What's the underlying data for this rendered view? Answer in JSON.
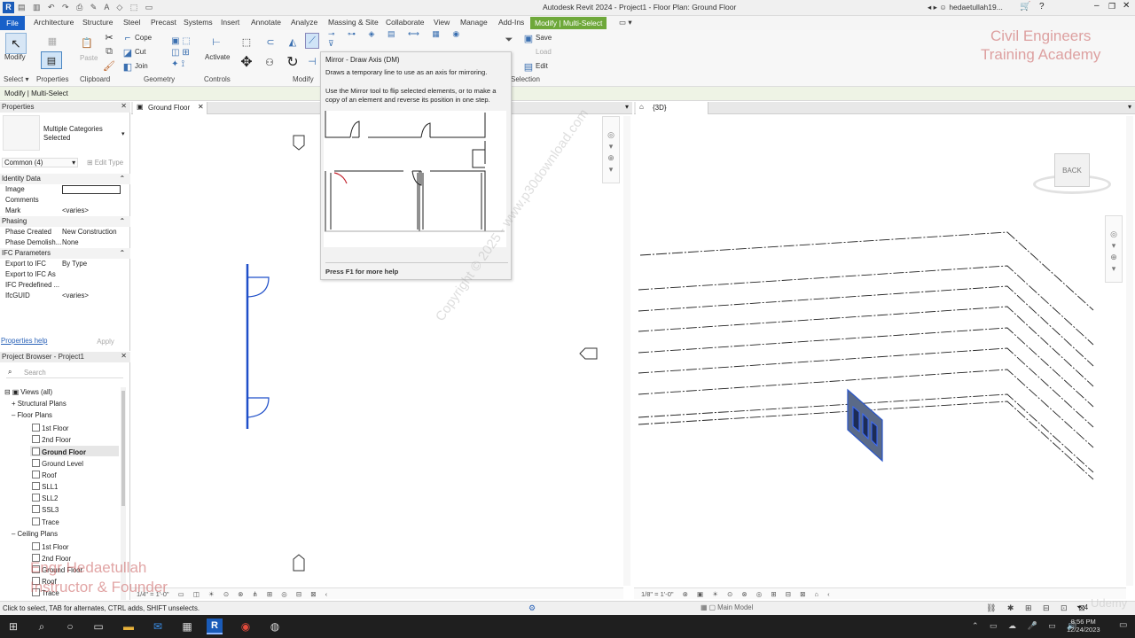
{
  "window": {
    "title": "Autodesk Revit 2024 - Project1 - Floor Plan: Ground Floor",
    "user": "hedaetullah19..."
  },
  "menu": {
    "file": "File",
    "tabs": [
      "Architecture",
      "Structure",
      "Steel",
      "Precast",
      "Systems",
      "Insert",
      "Annotate",
      "Analyze",
      "Massing & Site",
      "Collaborate",
      "View",
      "Manage",
      "Add-Ins"
    ],
    "active": "Modify | Multi-Select"
  },
  "ribbon": {
    "modify": "Modify",
    "cope": "Cope",
    "cut": "Cut",
    "join": "Join",
    "activate": "Activate",
    "save": "Save",
    "load": "Load",
    "edit": "Edit",
    "panels": {
      "select": "Select",
      "properties": "Properties",
      "clipboard": "Clipboard",
      "geometry": "Geometry",
      "controls": "Controls",
      "modify": "Modify",
      "selection": "Selection"
    }
  },
  "tooltip": {
    "title": "Mirror - Draw Axis (DM)",
    "line1": "Draws a temporary line to use as an axis for mirroring.",
    "line2": "Use the Mirror tool to flip selected elements, or to make a copy of an element and reverse its position in one step.",
    "help": "Press F1 for more help"
  },
  "options_bar": {
    "text": "Modify | Multi-Select"
  },
  "properties": {
    "title": "Properties",
    "type_name_line1": "Multiple Categories",
    "type_name_line2": "Selected",
    "filter": "Common (4)",
    "edit_type": "Edit Type",
    "identity": "Identity Data",
    "image": "Image",
    "comments": "Comments",
    "mark": "Mark",
    "mark_val": "<varies>",
    "phasing": "Phasing",
    "phase_created": "Phase Created",
    "phase_created_val": "New Construction",
    "phase_demolish": "Phase Demolish...",
    "phase_demolish_val": "None",
    "ifc": "IFC Parameters",
    "export_ifc": "Export to IFC",
    "export_ifc_val": "By Type",
    "export_ifc_as": "Export to IFC As",
    "ifc_predefined": "IFC Predefined ...",
    "ifcguid": "IfcGUID",
    "ifcguid_val": "<varies>",
    "help_link": "Properties help",
    "apply": "Apply"
  },
  "browser": {
    "title": "Project Browser - Project1",
    "search_placeholder": "Search",
    "views": "Views (all)",
    "structural": "Structural Plans",
    "floor_plans": "Floor Plans",
    "floors": [
      "1st Floor",
      "2nd Floor",
      "Ground Floor",
      "Ground Level",
      "Roof",
      "SLL1",
      "SLL2",
      "SSL3",
      "Trace"
    ],
    "ceiling": "Ceiling Plans",
    "ceilings": [
      "1st Floor",
      "2nd Floor",
      "Ground Floor",
      "Roof",
      "Trace"
    ]
  },
  "views": {
    "tab1": "Ground Floor",
    "tab2": "{3D}",
    "scale1": "1/4\" = 1'-0\"",
    "scale2": "1/8\" = 1'-0\"",
    "viewcube": "BACK"
  },
  "watermarks": {
    "academy_line1": "Civil Engineers",
    "academy_line2": "Training Academy",
    "copyright": "Copyright © 2025 - www.p30download.com",
    "instructor_line1": "Engr Hedaetullah",
    "instructor_line2": "Instructor & Founder",
    "udemy": "Udemy"
  },
  "status": {
    "hint": "Click to select, TAB for alternates, CTRL adds, SHIFT unselects.",
    "model": "Main Model",
    "filter_count": ":4"
  },
  "clock": {
    "time": "8:56 PM",
    "date": "12/24/2023"
  }
}
